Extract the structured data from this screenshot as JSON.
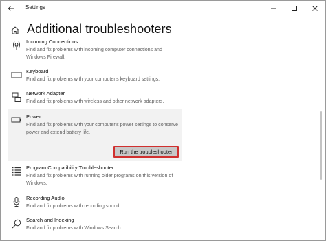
{
  "window": {
    "title": "Settings",
    "controls": [
      "minimize-icon",
      "maximize-icon",
      "close-icon"
    ]
  },
  "header": {
    "title": "Additional troubleshooters",
    "home_icon": "home-icon",
    "back_icon": "back-arrow-icon"
  },
  "items": [
    {
      "name": "Incoming Connections",
      "description": "Find and fix problems with incoming computer connections and Windows Firewall.",
      "icon": "wireless-signal-icon"
    },
    {
      "name": "Keyboard",
      "description": "Find and fix problems with your computer's keyboard settings.",
      "icon": "keyboard-icon"
    },
    {
      "name": "Network Adapter",
      "description": "Find and fix problems with wireless and other network adapters.",
      "icon": "network-adapter-icon"
    },
    {
      "name": "Power",
      "description": "Find and fix problems with your computer's power settings to conserve power and extend battery life.",
      "icon": "battery-icon",
      "selected": true,
      "button_label": "Run the troubleshooter"
    },
    {
      "name": "Program Compatibility Troubleshooter",
      "description": "Find and fix problems with running older programs on this version of Windows.",
      "icon": "program-list-icon"
    },
    {
      "name": "Recording Audio",
      "description": "Find and fix problems with recording sound",
      "icon": "microphone-icon"
    },
    {
      "name": "Search and Indexing",
      "description": "Find and fix problems with Windows Search",
      "icon": "search-icon"
    }
  ],
  "colors": {
    "highlight_border": "#d0302f",
    "selected_bg": "#f2f2f2",
    "button_bg": "#c8c8c8"
  }
}
